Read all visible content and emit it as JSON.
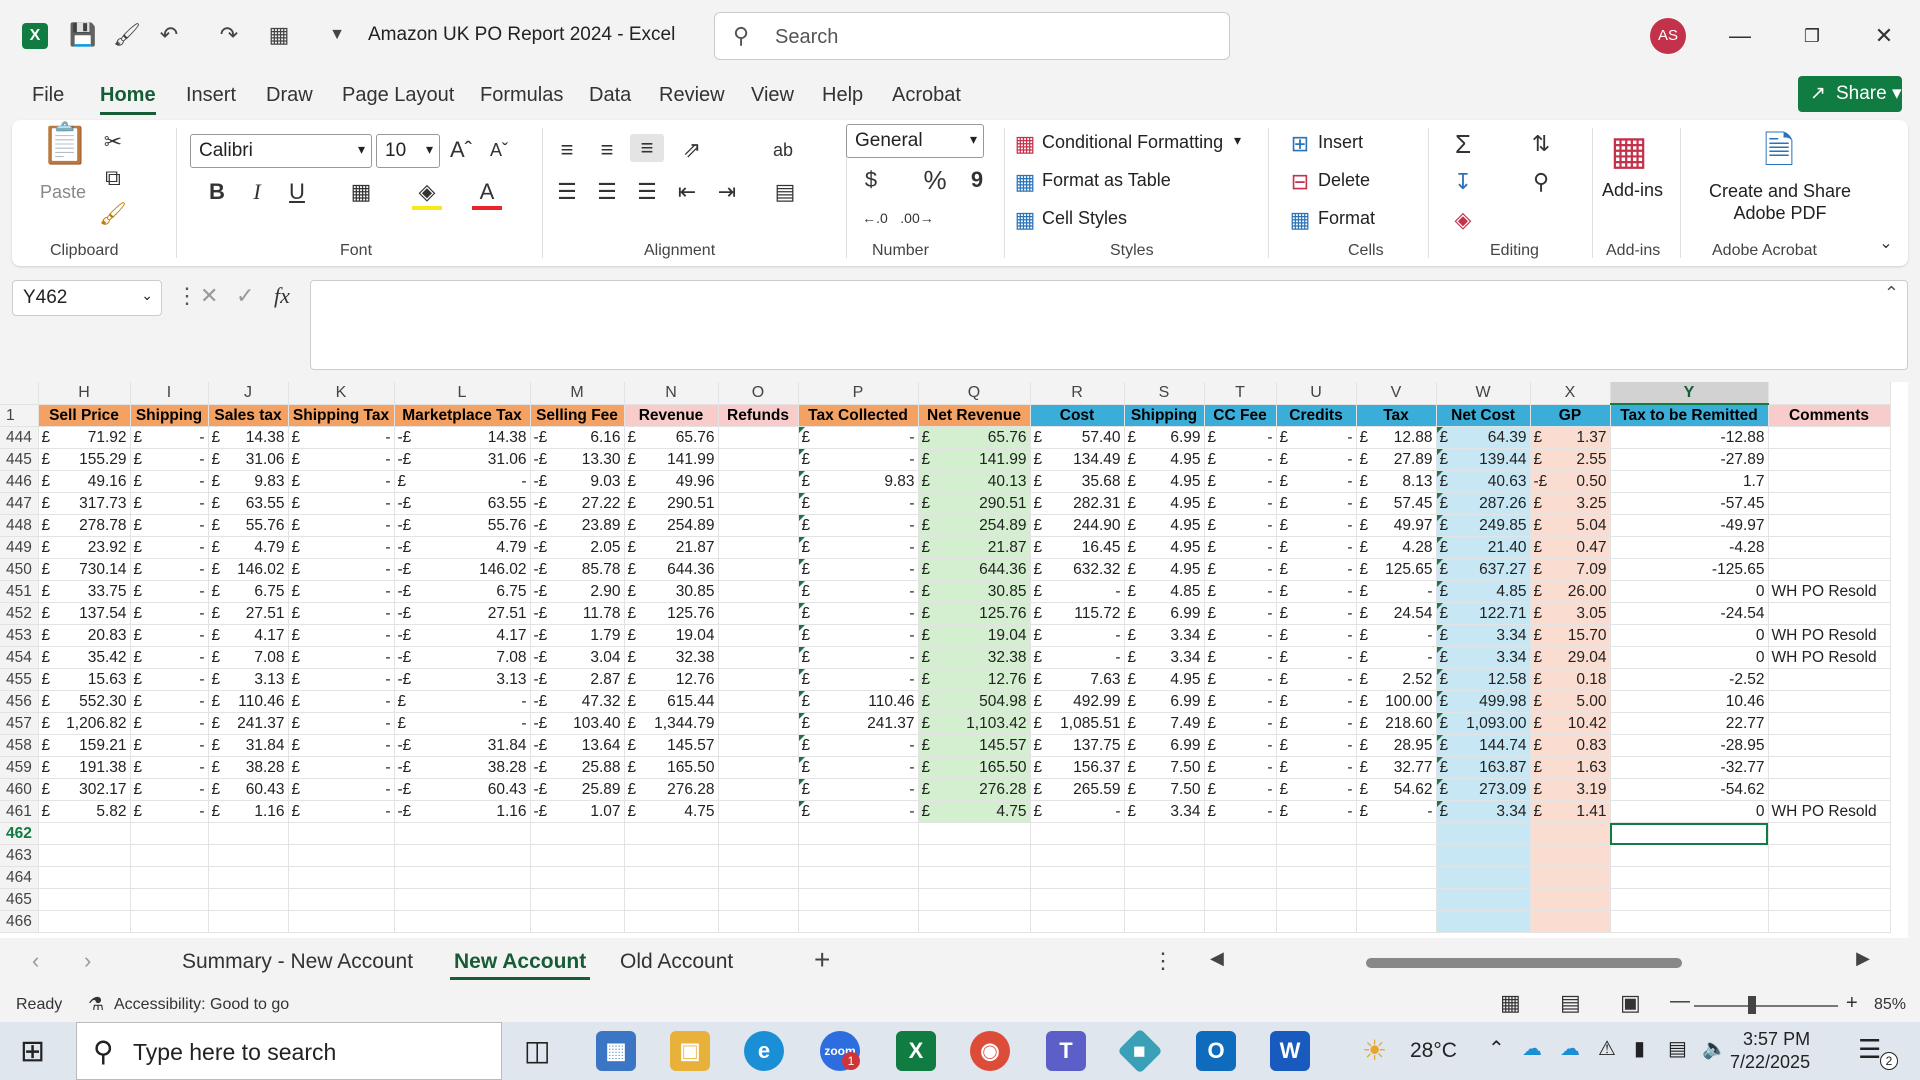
{
  "window": {
    "title": "Amazon UK PO Report 2024  -  Excel",
    "search_placeholder": "Search",
    "avatar_initials": "AS",
    "accent": "#107c41"
  },
  "menu": [
    "File",
    "Home",
    "Insert",
    "Draw",
    "Page Layout",
    "Formulas",
    "Data",
    "Review",
    "View",
    "Help",
    "Acrobat"
  ],
  "share_label": "Share",
  "ribbon": {
    "clipboard": {
      "paste": "Paste",
      "label": "Clipboard"
    },
    "font": {
      "name": "Calibri",
      "size": "10",
      "label": "Font",
      "bold": "B",
      "italic": "I",
      "underline": "U"
    },
    "alignment": {
      "label": "Alignment"
    },
    "number": {
      "format": "General",
      "label": "Number",
      "currency": "$",
      "percent": "%",
      "comma": "9"
    },
    "styles": {
      "conditional": "Conditional Formatting",
      "table": "Format as Table",
      "cell": "Cell Styles",
      "label": "Styles"
    },
    "cells": {
      "insert": "Insert",
      "delete": "Delete",
      "format": "Format",
      "label": "Cells"
    },
    "editing": {
      "label": "Editing"
    },
    "addins": {
      "btn": "Add-ins",
      "label": "Add-ins"
    },
    "acrobat": {
      "btn_line1": "Create and Share",
      "btn_line2": "Adobe PDF",
      "label": "Adobe Acrobat"
    }
  },
  "namebox": "Y462",
  "fx_label": "fx",
  "columns": [
    "H",
    "I",
    "J",
    "K",
    "L",
    "M",
    "N",
    "O",
    "P",
    "Q",
    "R",
    "S",
    "T",
    "U",
    "V",
    "W",
    "X",
    "Y",
    ""
  ],
  "headers": [
    "Sell Price",
    "Shipping",
    "Sales tax",
    "Shipping Tax",
    "Marketplace Tax",
    "Selling Fee",
    "Revenue",
    "Refunds",
    "Tax Collected",
    "Net Revenue",
    "Cost",
    "Shipping",
    "CC Fee",
    "Credits",
    "Tax",
    "Net Cost",
    "GP",
    "Tax to be Remitted",
    "Comments"
  ],
  "header_row_number": "1",
  "rows": [
    {
      "n": "444",
      "H": "71.92",
      "J": "14.38",
      "Lneg": true,
      "L": "14.38",
      "M": "6.16",
      "N": "65.76",
      "P": "-",
      "Q": "65.76",
      "R": "57.40",
      "S": "6.99",
      "V": "12.88",
      "W": "64.39",
      "Xneg": false,
      "X": "1.37",
      "Y": "-12.88",
      "Z": ""
    },
    {
      "n": "445",
      "H": "155.29",
      "J": "31.06",
      "Lneg": true,
      "L": "31.06",
      "M": "13.30",
      "N": "141.99",
      "P": "-",
      "Q": "141.99",
      "R": "134.49",
      "S": "4.95",
      "V": "27.89",
      "W": "139.44",
      "Xneg": false,
      "X": "2.55",
      "Y": "-27.89",
      "Z": ""
    },
    {
      "n": "446",
      "H": "49.16",
      "J": "9.83",
      "Lneg": false,
      "L": "-",
      "M": "9.03",
      "N": "49.96",
      "P": "9.83",
      "Q": "40.13",
      "R": "35.68",
      "S": "4.95",
      "V": "8.13",
      "W": "40.63",
      "Xneg": true,
      "X": "0.50",
      "Y": "1.7",
      "Z": ""
    },
    {
      "n": "447",
      "H": "317.73",
      "J": "63.55",
      "Lneg": true,
      "L": "63.55",
      "M": "27.22",
      "N": "290.51",
      "P": "-",
      "Q": "290.51",
      "R": "282.31",
      "S": "4.95",
      "V": "57.45",
      "W": "287.26",
      "Xneg": false,
      "X": "3.25",
      "Y": "-57.45",
      "Z": ""
    },
    {
      "n": "448",
      "H": "278.78",
      "J": "55.76",
      "Lneg": true,
      "L": "55.76",
      "M": "23.89",
      "N": "254.89",
      "P": "-",
      "Q": "254.89",
      "R": "244.90",
      "S": "4.95",
      "V": "49.97",
      "W": "249.85",
      "Xneg": false,
      "X": "5.04",
      "Y": "-49.97",
      "Z": ""
    },
    {
      "n": "449",
      "H": "23.92",
      "J": "4.79",
      "Lneg": true,
      "L": "4.79",
      "M": "2.05",
      "N": "21.87",
      "P": "-",
      "Q": "21.87",
      "R": "16.45",
      "S": "4.95",
      "V": "4.28",
      "W": "21.40",
      "Xneg": false,
      "X": "0.47",
      "Y": "-4.28",
      "Z": ""
    },
    {
      "n": "450",
      "H": "730.14",
      "J": "146.02",
      "Lneg": true,
      "L": "146.02",
      "M": "85.78",
      "N": "644.36",
      "P": "-",
      "Q": "644.36",
      "R": "632.32",
      "S": "4.95",
      "V": "125.65",
      "W": "637.27",
      "Xneg": false,
      "X": "7.09",
      "Y": "-125.65",
      "Z": ""
    },
    {
      "n": "451",
      "H": "33.75",
      "J": "6.75",
      "Lneg": true,
      "L": "6.75",
      "M": "2.90",
      "N": "30.85",
      "P": "-",
      "Q": "30.85",
      "R": "-",
      "S": "4.85",
      "V": "-",
      "W": "4.85",
      "Xneg": false,
      "X": "26.00",
      "Y": "0",
      "Z": "WH PO Resold"
    },
    {
      "n": "452",
      "H": "137.54",
      "J": "27.51",
      "Lneg": true,
      "L": "27.51",
      "M": "11.78",
      "N": "125.76",
      "P": "-",
      "Q": "125.76",
      "R": "115.72",
      "S": "6.99",
      "V": "24.54",
      "W": "122.71",
      "Xneg": false,
      "X": "3.05",
      "Y": "-24.54",
      "Z": ""
    },
    {
      "n": "453",
      "H": "20.83",
      "J": "4.17",
      "Lneg": true,
      "L": "4.17",
      "M": "1.79",
      "N": "19.04",
      "P": "-",
      "Q": "19.04",
      "R": "-",
      "S": "3.34",
      "V": "-",
      "W": "3.34",
      "Xneg": false,
      "X": "15.70",
      "Y": "0",
      "Z": "WH PO Resold"
    },
    {
      "n": "454",
      "H": "35.42",
      "J": "7.08",
      "Lneg": true,
      "L": "7.08",
      "M": "3.04",
      "N": "32.38",
      "P": "-",
      "Q": "32.38",
      "R": "-",
      "S": "3.34",
      "V": "-",
      "W": "3.34",
      "Xneg": false,
      "X": "29.04",
      "Y": "0",
      "Z": "WH PO Resold"
    },
    {
      "n": "455",
      "H": "15.63",
      "J": "3.13",
      "Lneg": true,
      "L": "3.13",
      "M": "2.87",
      "N": "12.76",
      "P": "-",
      "Q": "12.76",
      "R": "7.63",
      "S": "4.95",
      "V": "2.52",
      "W": "12.58",
      "Xneg": false,
      "X": "0.18",
      "Y": "-2.52",
      "Z": ""
    },
    {
      "n": "456",
      "H": "552.30",
      "J": "110.46",
      "Lneg": false,
      "L": "-",
      "M": "47.32",
      "N": "615.44",
      "P": "110.46",
      "Q": "504.98",
      "R": "492.99",
      "S": "6.99",
      "V": "100.00",
      "W": "499.98",
      "Xneg": false,
      "X": "5.00",
      "Y": "10.46",
      "Z": ""
    },
    {
      "n": "457",
      "H": "1,206.82",
      "J": "241.37",
      "Lneg": false,
      "L": "-",
      "M": "103.40",
      "N": "1,344.79",
      "P": "241.37",
      "Q": "1,103.42",
      "R": "1,085.51",
      "S": "7.49",
      "V": "218.60",
      "W": "1,093.00",
      "Xneg": false,
      "X": "10.42",
      "Y": "22.77",
      "Z": ""
    },
    {
      "n": "458",
      "H": "159.21",
      "J": "31.84",
      "Lneg": true,
      "L": "31.84",
      "M": "13.64",
      "N": "145.57",
      "P": "-",
      "Q": "145.57",
      "R": "137.75",
      "S": "6.99",
      "V": "28.95",
      "W": "144.74",
      "Xneg": false,
      "X": "0.83",
      "Y": "-28.95",
      "Z": ""
    },
    {
      "n": "459",
      "H": "191.38",
      "J": "38.28",
      "Lneg": true,
      "L": "38.28",
      "M": "25.88",
      "N": "165.50",
      "P": "-",
      "Q": "165.50",
      "R": "156.37",
      "S": "7.50",
      "V": "32.77",
      "W": "163.87",
      "Xneg": false,
      "X": "1.63",
      "Y": "-32.77",
      "Z": ""
    },
    {
      "n": "460",
      "H": "302.17",
      "J": "60.43",
      "Lneg": true,
      "L": "60.43",
      "M": "25.89",
      "N": "276.28",
      "P": "-",
      "Q": "276.28",
      "R": "265.59",
      "S": "7.50",
      "V": "54.62",
      "W": "273.09",
      "Xneg": false,
      "X": "3.19",
      "Y": "-54.62",
      "Z": ""
    },
    {
      "n": "461",
      "H": "5.82",
      "J": "1.16",
      "Lneg": true,
      "L": "1.16",
      "M": "1.07",
      "N": "4.75",
      "P": "-",
      "Q": "4.75",
      "R": "-",
      "S": "3.34",
      "V": "-",
      "W": "3.34",
      "Xneg": false,
      "X": "1.41",
      "Y": "0",
      "Z": "WH PO Resold"
    }
  ],
  "empty_rows": [
    "462",
    "463",
    "464",
    "465",
    "466"
  ],
  "currency_symbol": "£",
  "dash": "-",
  "neg_currency": "-£",
  "sheets": [
    "Summary - New Account",
    "New Account",
    "Old Account"
  ],
  "add_sheet": "+",
  "status": {
    "ready": "Ready",
    "accessibility": "Accessibility: Good to go",
    "zoom": "85%"
  },
  "taskbar": {
    "search_placeholder": "Type here to search",
    "weather": "28°C",
    "time": "3:57 PM",
    "date": "7/22/2025",
    "notification_count": "2",
    "zoom_badge": "1"
  }
}
